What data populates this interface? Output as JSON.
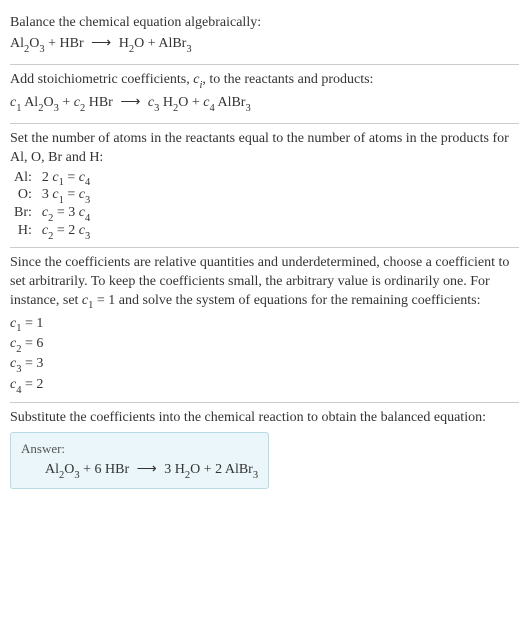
{
  "intro": {
    "line1": "Balance the chemical equation algebraically:",
    "eq_lhs_1": "Al",
    "eq_lhs_1_sub": "2",
    "eq_lhs_2": "O",
    "eq_lhs_2_sub": "3",
    "plus1": " + HBr ",
    "arrow": "⟶",
    "eq_rhs_1": " H",
    "eq_rhs_1_sub": "2",
    "eq_rhs_2": "O + AlBr",
    "eq_rhs_2_sub": "3"
  },
  "step1": {
    "text_a": "Add stoichiometric coefficients, ",
    "ci": "c",
    "ci_sub": "i",
    "text_b": ", to the reactants and products:",
    "c1": "c",
    "c1s": "1",
    "sp1": " Al",
    "sp1s2": "2",
    "sp1b": "O",
    "sp1s3": "3",
    "plus1": " + ",
    "c2": "c",
    "c2s": "2",
    "sp2": " HBr ",
    "arrow": "⟶",
    "sp3pre": " ",
    "c3": "c",
    "c3s": "3",
    "sp3": " H",
    "sp3s": "2",
    "sp3b": "O + ",
    "c4": "c",
    "c4s": "4",
    "sp4": " AlBr",
    "sp4s": "3"
  },
  "step2": {
    "text": "Set the number of atoms in the reactants equal to the number of atoms in the products for Al, O, Br and H:",
    "rows": [
      {
        "el": "Al:",
        "lhs_coef": "2 ",
        "lhs_c": "c",
        "lhs_s": "1",
        "eq": " = ",
        "rhs_c": "c",
        "rhs_s": "4",
        "rhs_coef": ""
      },
      {
        "el": "O:",
        "lhs_coef": "3 ",
        "lhs_c": "c",
        "lhs_s": "1",
        "eq": " = ",
        "rhs_c": "c",
        "rhs_s": "3",
        "rhs_coef": ""
      },
      {
        "el": "Br:",
        "lhs_coef": "",
        "lhs_c": "c",
        "lhs_s": "2",
        "eq": " = 3 ",
        "rhs_c": "c",
        "rhs_s": "4",
        "rhs_coef": ""
      },
      {
        "el": "H:",
        "lhs_coef": "",
        "lhs_c": "c",
        "lhs_s": "2",
        "eq": " = 2 ",
        "rhs_c": "c",
        "rhs_s": "3",
        "rhs_coef": ""
      }
    ]
  },
  "step3": {
    "text_a": "Since the coefficients are relative quantities and underdetermined, choose a coefficient to set arbitrarily. To keep the coefficients small, the arbitrary value is ordinarily one. For instance, set ",
    "c1": "c",
    "c1s": "1",
    "text_b": " = 1 and solve the system of equations for the remaining coefficients:",
    "coeffs": [
      {
        "c": "c",
        "s": "1",
        "eq": " = 1"
      },
      {
        "c": "c",
        "s": "2",
        "eq": " = 6"
      },
      {
        "c": "c",
        "s": "3",
        "eq": " = 3"
      },
      {
        "c": "c",
        "s": "4",
        "eq": " = 2"
      }
    ]
  },
  "step4": {
    "text": "Substitute the coefficients into the chemical reaction to obtain the balanced equation:"
  },
  "answer": {
    "label": "Answer:",
    "lhs1": "Al",
    "lhs1s": "2",
    "lhs1b": "O",
    "lhs1s2": "3",
    "plus1": " + 6 HBr ",
    "arrow": "⟶",
    "rhs1": " 3 H",
    "rhs1s": "2",
    "rhs1b": "O + 2 AlBr",
    "rhs1s2": "3"
  }
}
